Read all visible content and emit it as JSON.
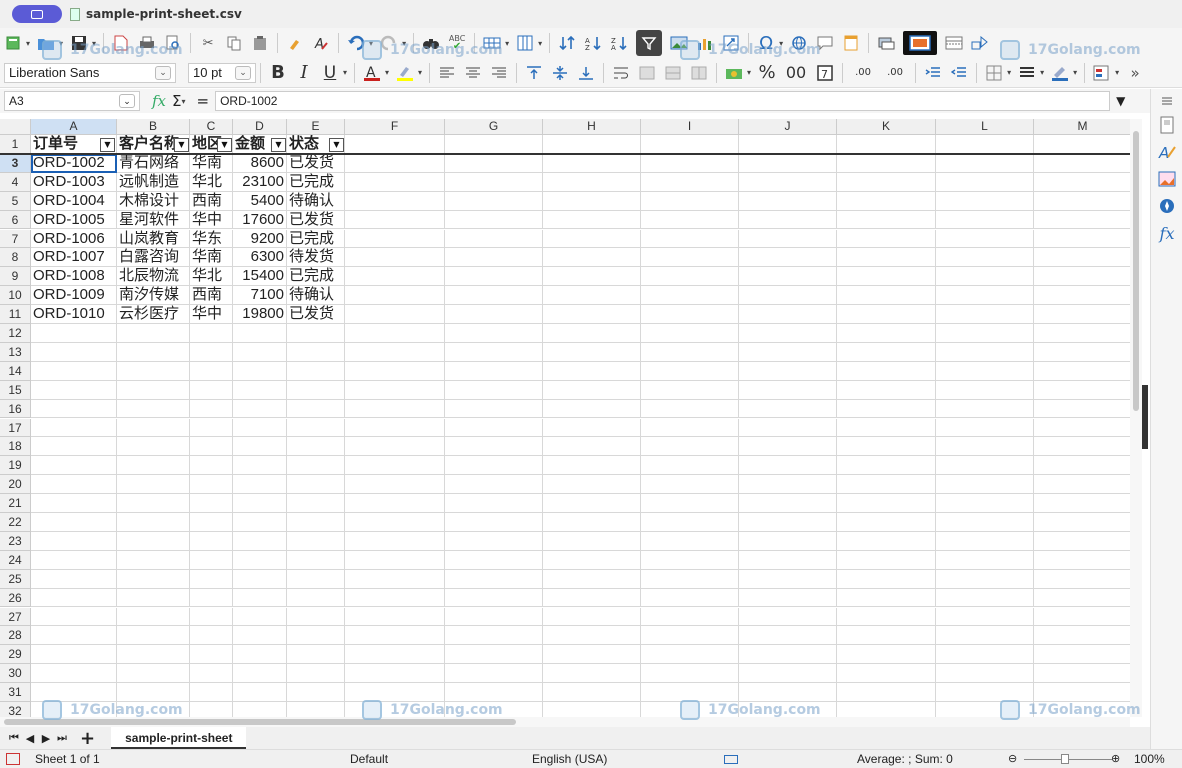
{
  "window": {
    "title": "sample-print-sheet.csv"
  },
  "toolbar": {
    "font_name": "Liberation Sans",
    "font_size": "10 pt",
    "bold": "B",
    "italic": "I",
    "underline": "U",
    "percent": "%",
    "decimal": "00",
    "add_decimal": ".00",
    "del_decimal": ".00",
    "spellcheck": "ABC",
    "special_char": "Ω",
    "more": "»"
  },
  "formula_bar": {
    "cell_ref": "A3",
    "fx": "fx",
    "sigma": "Σ",
    "equals": "=",
    "content": "ORD-1002"
  },
  "watermark": "17Golang.com",
  "columns": [
    "A",
    "B",
    "C",
    "D",
    "E",
    "F",
    "G",
    "H",
    "I",
    "J",
    "K",
    "L",
    "M"
  ],
  "row_numbers": [
    "1",
    "3",
    "4",
    "5",
    "6",
    "7",
    "8",
    "9",
    "10",
    "11",
    "12",
    "13",
    "14",
    "15",
    "16",
    "17",
    "18",
    "19",
    "20",
    "21",
    "22",
    "23",
    "24",
    "25",
    "26",
    "27",
    "28",
    "29",
    "30",
    "31",
    "32"
  ],
  "header_row": [
    "订单号",
    "客户名称",
    "地区",
    "金额",
    "状态"
  ],
  "rows": [
    [
      "ORD-1002",
      "青石网络",
      "华南",
      "8600",
      "已发货"
    ],
    [
      "ORD-1003",
      "远帆制造",
      "华北",
      "23100",
      "已完成"
    ],
    [
      "ORD-1004",
      "木棉设计",
      "西南",
      "5400",
      "待确认"
    ],
    [
      "ORD-1005",
      "星河软件",
      "华中",
      "17600",
      "已发货"
    ],
    [
      "ORD-1006",
      "山岚教育",
      "华东",
      "9200",
      "已完成"
    ],
    [
      "ORD-1007",
      "白露咨询",
      "华南",
      "6300",
      "待发货"
    ],
    [
      "ORD-1008",
      "北辰物流",
      "华北",
      "15400",
      "已完成"
    ],
    [
      "ORD-1009",
      "南汐传媒",
      "西南",
      "7100",
      "待确认"
    ],
    [
      "ORD-1010",
      "云杉医疗",
      "华中",
      "19800",
      "已发货"
    ]
  ],
  "sheet_tab": "sample-print-sheet",
  "status": {
    "sheet": "Sheet 1 of 1",
    "style": "Default",
    "language": "English (USA)",
    "summary": "Average: ; Sum: 0",
    "zoom": "100%"
  },
  "colors": {
    "accent": "#1a5fb4",
    "selected_header": "#cfe0f3",
    "app_button": "#5b5bd6"
  }
}
